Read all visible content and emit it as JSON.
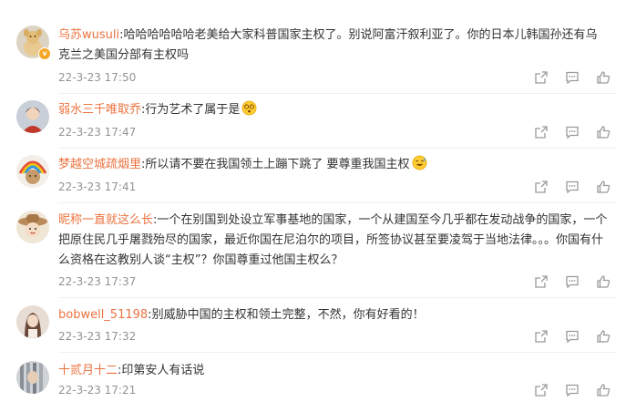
{
  "comments": [
    {
      "username": "乌苏wusuli",
      "colon": ":",
      "text": "哈哈哈哈哈哈老美给大家科普国家主权了。别说阿富汗叙利亚了。你的日本儿韩国孙还有乌克兰之美国分部有主权吗",
      "time": "22-3-23 17:50",
      "verified": true
    },
    {
      "username": "弱水三千唯取乔",
      "colon": ":",
      "text": "行为艺术了属于是",
      "time": "22-3-23 17:47",
      "emoji": "dizzy-face"
    },
    {
      "username": "梦越空城疏烟里",
      "colon": ":",
      "text": "所以请不要在我国领土上蹦下跳了 要尊重我国主权",
      "time": "22-3-23 17:41",
      "emoji": "sweat-smile-face"
    },
    {
      "username": "昵称一直就这么长",
      "colon": ":",
      "text": "一个在别国到处设立军事基地的国家，一个从建国至今几乎都在发动战争的国家，一个把原住民几乎屠戮殆尽的国家，最近你国在尼泊尔的项目，所签协议甚至要凌驾于当地法律。。。你国有什么资格在这教别人谈“主权”？你国尊重过他国主权么？",
      "time": "22-3-23 17:37"
    },
    {
      "username": "bobwell_51198",
      "colon": ":",
      "text": "别威胁中国的主权和领土完整，不然，你有好看的！",
      "time": "22-3-23 17:32"
    },
    {
      "username": "十贰月十二",
      "colon": ":",
      "text": "印第安人有话说",
      "time": "22-3-23 17:21"
    }
  ],
  "actions": [
    "share-icon",
    "comment-icon",
    "like-icon"
  ]
}
